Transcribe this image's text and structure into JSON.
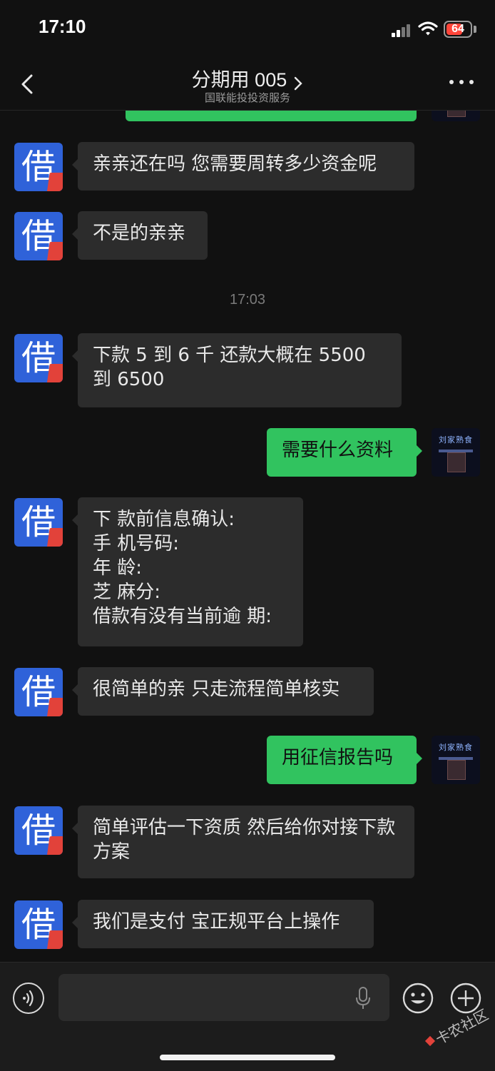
{
  "status_bar": {
    "time": "17:10",
    "battery": "64"
  },
  "nav": {
    "title": "分期用 005",
    "subtitle": "国联能投投资服务"
  },
  "avatars": {
    "loan_glyph": "借",
    "shop_sign": "刘家熟食"
  },
  "messages": [
    {
      "from": "them",
      "text": "亲亲还在吗 您需要周转多少资金呢"
    },
    {
      "from": "them",
      "text": "不是的亲亲"
    },
    {
      "type": "time",
      "text": "17:03"
    },
    {
      "from": "them",
      "text": "下款 5 到 6 千  还款大概在 5500 到 6500"
    },
    {
      "from": "me",
      "text": "需要什么资料"
    },
    {
      "from": "them",
      "text": "下 款前信息确认:\n手 机号码:\n年 龄:\n芝 麻分:\n借款有没有当前逾 期:"
    },
    {
      "from": "them",
      "text": "很简单的亲 只走流程简单核实"
    },
    {
      "from": "me",
      "text": "用征信报告吗"
    },
    {
      "from": "them",
      "text": "简单评估一下资质 然后给你对接下款方案"
    },
    {
      "from": "them",
      "text": "我们是支付 宝正规平台上操作"
    }
  ],
  "watermark": {
    "text": "卡农社区"
  },
  "colors": {
    "outgoing_bubble": "#31c35f",
    "incoming_bubble": "#2c2c2c",
    "background": "#111111",
    "avatar_blue": "#2f62d9"
  }
}
